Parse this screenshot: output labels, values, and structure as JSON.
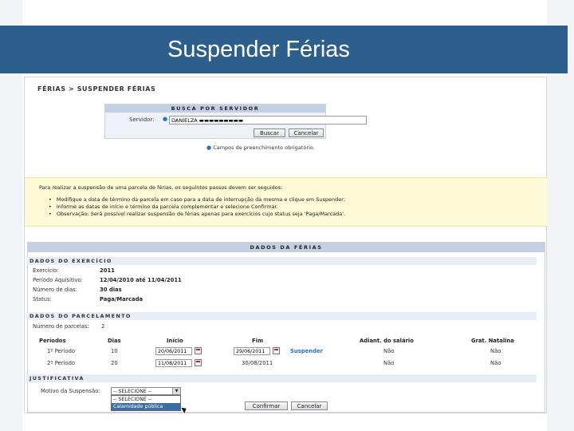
{
  "slide": {
    "title": "Suspender Férias"
  },
  "breadcrumb": "FÉRIAS > SUSPENDER FÉRIAS",
  "search": {
    "caption": "BUSCA POR SERVIDOR",
    "servidor_label": "Servidor:",
    "servidor_value": "DANIELZA ▬▬▬▬▬▬▬▬▬",
    "search_button": "Buscar",
    "cancel_button": "Cancelar",
    "required_note": "Campos de preenchimento obrigatório."
  },
  "info": {
    "intro": "Para realizar a suspensão de uma parcela de férias, os seguintes passos devem ser seguidos:",
    "steps": [
      "Modifique a data de término da parcela em caso para a data de interrupção da mesma e clique em Suspender;",
      "Informe as datas de início e término da parcela complementar e selecione Confirmar.",
      "Observação: Será possível realizar suspensão de férias apenas para exercícios cujo status seja 'Paga/Marcada'."
    ]
  },
  "dados": {
    "caption": "DADOS DA FÉRIAS",
    "exercicio_head": "DADOS DO EXERCÍCIO",
    "exercicio": [
      {
        "label": "Exercício:",
        "value": "2011"
      },
      {
        "label": "Período Aquisitivo:",
        "value": "12/04/2010 até 11/04/2011"
      },
      {
        "label": "Número de dias:",
        "value": "30 dias"
      },
      {
        "label": "Status:",
        "value": "Paga/Marcada"
      }
    ],
    "parcelamento_head": "DADOS DO PARCELAMENTO",
    "num_parcelas_label": "Número de parcelas:",
    "num_parcelas_value": "2",
    "columns": [
      "Períodos",
      "Dias",
      "Início",
      "Fim",
      "Adiant. do salário",
      "Grat. Natalina"
    ],
    "rows": [
      {
        "periodo": "1º Período",
        "dias": "10",
        "inicio": "20/06/2011",
        "fim": "29/06/2011",
        "acao": "Suspender",
        "adiant": "Não",
        "grat": "Não"
      },
      {
        "periodo": "2º Período",
        "dias": "20",
        "inicio": "11/08/2011",
        "fim": "30/08/2011",
        "acao": "",
        "adiant": "Não",
        "grat": "Não"
      }
    ],
    "justificativa_head": "JUSTIFICATIVA",
    "motivo_label": "Motivo da Suspensão:",
    "motivo_selected": "-- SELECIONE --",
    "motivo_options": [
      "-- SELECIONE --",
      "Calamidade pública"
    ],
    "confirm_button": "Confirmar",
    "cancel_button": "Cancelar"
  },
  "colors": {
    "title_bar": "#2d5f8c",
    "panel_caption": "#c3d0e4",
    "info_bg": "#fbf9d6",
    "link": "#2c6fbd"
  }
}
